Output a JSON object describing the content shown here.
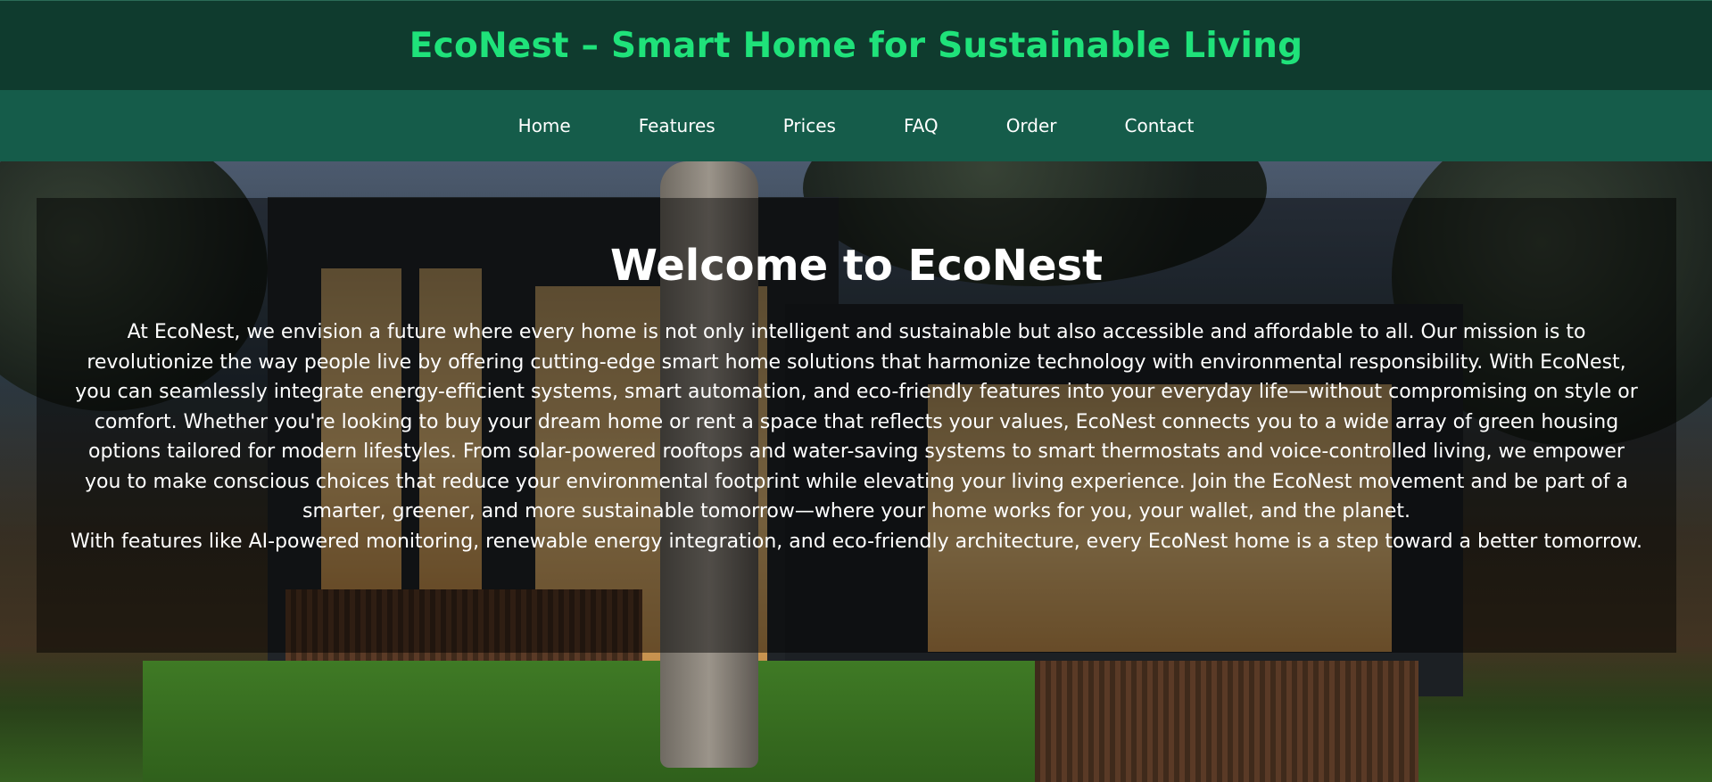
{
  "header": {
    "title": "EcoNest – Smart Home for Sustainable Living"
  },
  "nav": {
    "items": [
      {
        "label": "Home"
      },
      {
        "label": "Features"
      },
      {
        "label": "Prices"
      },
      {
        "label": "FAQ"
      },
      {
        "label": "Order"
      },
      {
        "label": "Contact"
      }
    ]
  },
  "hero": {
    "heading": "Welcome to EcoNest",
    "paragraph_1": "At EcoNest, we envision a future where every home is not only intelligent and sustainable but also accessible and affordable to all. Our mission is to revolutionize the way people live by offering cutting-edge smart home solutions that harmonize technology with environmental responsibility. With EcoNest, you can seamlessly integrate energy-efficient systems, smart automation, and eco-friendly features into your everyday life—without compromising on style or comfort. Whether you're looking to buy your dream home or rent a space that reflects your values, EcoNest connects you to a wide array of green housing options tailored for modern lifestyles. From solar-powered rooftops and water-saving systems to smart thermostats and voice-controlled living, we empower you to make conscious choices that reduce your environmental footprint while elevating your living experience. Join the EcoNest movement and be part of a smarter, greener, and more sustainable tomorrow—where your home works for you, your wallet, and the planet.",
    "paragraph_2": "With features like AI-powered monitoring, renewable energy integration, and eco-friendly architecture, every EcoNest home is a step toward a better tomorrow."
  },
  "colors": {
    "header_bg": "#0f3b2e",
    "title_color": "#1fe27a",
    "nav_bg": "#155c4a"
  }
}
